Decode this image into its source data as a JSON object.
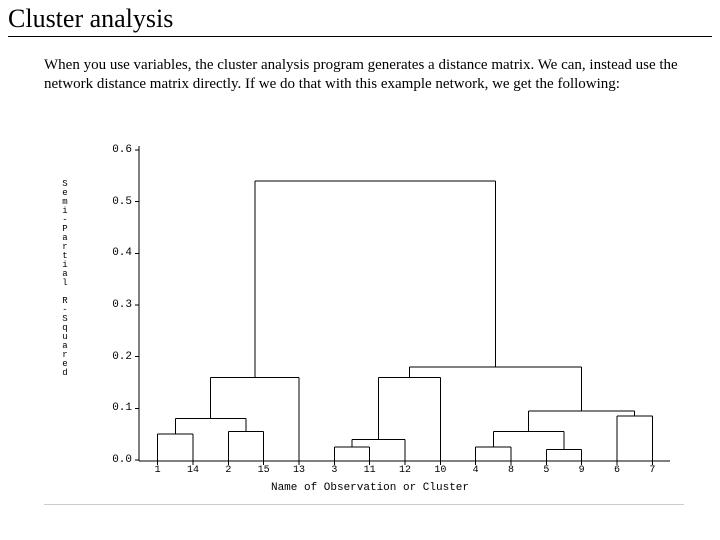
{
  "title": "Cluster analysis",
  "paragraph": "When you use variables, the cluster analysis program generates a distance matrix.  We can, instead use the network distance matrix directly.   If we do that with this example network, we get the following:",
  "chart_data": {
    "type": "dendrogram",
    "xlabel": "Name of Observation or Cluster",
    "ylabel_stacked": "Semi-Partial R-Squared",
    "ylabel_chars": [
      "S",
      "e",
      "m",
      "i",
      "-",
      "P",
      "a",
      "r",
      "t",
      "i",
      "a",
      "l",
      "",
      "R",
      "-",
      "S",
      "q",
      "u",
      "a",
      "r",
      "e",
      "d"
    ],
    "ylim": [
      0.0,
      0.6
    ],
    "yticks": [
      "0.0",
      "0.1",
      "0.2",
      "0.3",
      "0.4",
      "0.5",
      "0.6"
    ],
    "leaf_order": [
      "1",
      "14",
      "2",
      "15",
      "13",
      "3",
      "11",
      "12",
      "10",
      "4",
      "8",
      "5",
      "9",
      "6",
      "7"
    ],
    "left_cluster": {
      "leaves": [
        "1",
        "14",
        "2",
        "15",
        "13"
      ],
      "merges": [
        {
          "join": [
            "1",
            "14"
          ],
          "height": 0.05
        },
        {
          "join": [
            "2",
            "15"
          ],
          "height": 0.055
        },
        {
          "join": [
            "(1,14)",
            "(2,15)"
          ],
          "height": 0.08
        },
        {
          "join": [
            "(1,14,2,15)",
            "13"
          ],
          "height": 0.16
        }
      ]
    },
    "right_cluster": {
      "leaves": [
        "3",
        "11",
        "12",
        "10",
        "4",
        "8",
        "5",
        "9",
        "6",
        "7"
      ],
      "merges": [
        {
          "join": [
            "3",
            "11"
          ],
          "height": 0.025
        },
        {
          "join": [
            "(3,11)",
            "12"
          ],
          "height": 0.04
        },
        {
          "join": [
            "(3,11,12)",
            "10"
          ],
          "height": 0.16
        },
        {
          "join": [
            "4",
            "8"
          ],
          "height": 0.025
        },
        {
          "join": [
            "5",
            "9"
          ],
          "height": 0.02
        },
        {
          "join": [
            "(4,8)",
            "(5,9)"
          ],
          "height": 0.055
        },
        {
          "join": [
            "6",
            "7"
          ],
          "height": 0.085
        },
        {
          "join": [
            "(4,8,5,9)",
            "(6,7)"
          ],
          "height": 0.095
        },
        {
          "join": [
            "(3,11,12,10)",
            "(4,8,5,9,6,7)"
          ],
          "height": 0.18
        }
      ]
    },
    "root_merge": {
      "join": [
        "left_cluster",
        "right_cluster"
      ],
      "height": 0.54
    }
  }
}
